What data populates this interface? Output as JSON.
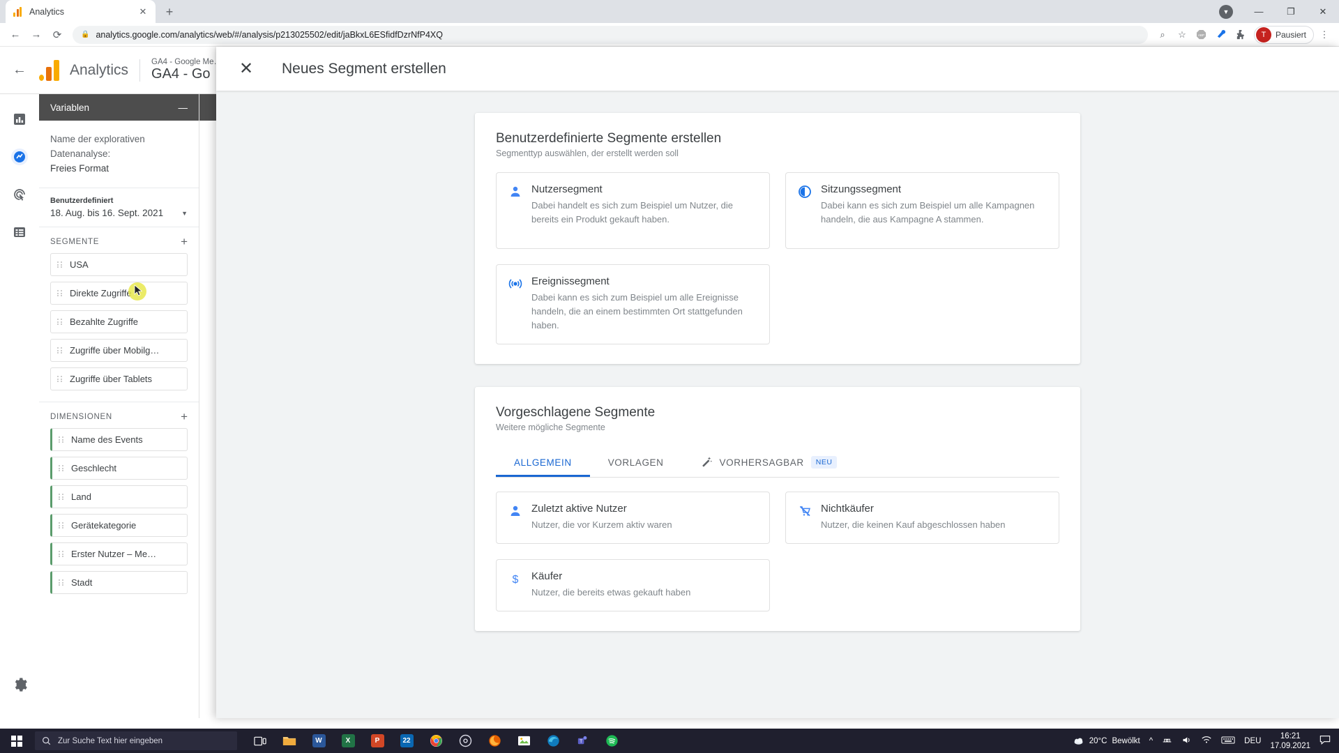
{
  "browser": {
    "tab": {
      "title": "Analytics",
      "favicon": "analytics-icon",
      "close": "✕"
    },
    "new_tab": "+",
    "window_controls": {
      "minimize": "—",
      "maximize": "❐",
      "close": "✕"
    },
    "nav": {
      "back": "←",
      "forward": "→",
      "reload": "⟳"
    },
    "omnibox": {
      "lock": "🔒",
      "url": "analytics.google.com/analytics/web/#/analysis/p213025502/edit/jaBkxL6ESfidfDzrNfP4XQ"
    },
    "toolbar_icons": [
      "zoom-icon",
      "bookmark-star-icon",
      "adblock-icon",
      "extension-blue-icon",
      "extensions-puzzle-icon"
    ],
    "profile": {
      "initial": "T",
      "label": "Pausiert"
    },
    "menu": "⋮"
  },
  "app": {
    "back": "←",
    "brand": "Analytics",
    "property_small": "GA4 - Google Me…",
    "property_big": "GA4 - Go",
    "rail": [
      "reports-icon",
      "explore-icon",
      "advertising-icon",
      "configure-icon",
      "admin-gear-icon"
    ]
  },
  "variables": {
    "header": "Variablen",
    "collapse": "—",
    "analysis_label": "Name der explorativen Datenanalyse:",
    "analysis_value": "Freies Format",
    "date_label": "Benutzerdefiniert",
    "date_value": "18. Aug. bis 16. Sept. 2021",
    "segments": {
      "title": "SEGMENTE",
      "add": "+",
      "items": [
        "USA",
        "Direkte Zugriffe",
        "Bezahlte Zugriffe",
        "Zugriffe über Mobilg…",
        "Zugriffe über Tablets"
      ]
    },
    "dimensions": {
      "title": "DIMENSIONEN",
      "add": "+",
      "items": [
        "Name des Events",
        "Geschlecht",
        "Land",
        "Gerätekategorie",
        "Erster Nutzer – Me…",
        "Stadt"
      ]
    }
  },
  "modal": {
    "close": "✕",
    "title": "Neues Segment erstellen",
    "custom": {
      "title": "Benutzerdefinierte Segmente erstellen",
      "subtitle": "Segmenttyp auswählen, der erstellt werden soll",
      "tiles": [
        {
          "icon": "person-icon",
          "name": "Nutzersegment",
          "desc": "Dabei handelt es sich zum Beispiel um Nutzer, die bereits ein Produkt gekauft haben."
        },
        {
          "icon": "session-clock-icon",
          "name": "Sitzungssegment",
          "desc": "Dabei kann es sich zum Beispiel um alle Kampagnen handeln, die aus Kampagne A stammen."
        },
        {
          "icon": "event-target-icon",
          "name": "Ereignissegment",
          "desc": "Dabei kann es sich zum Beispiel um alle Ereignisse handeln, die an einem bestimmten Ort stattgefunden haben."
        }
      ]
    },
    "suggested": {
      "title": "Vorgeschlagene Segmente",
      "subtitle": "Weitere mögliche Segmente",
      "tabs": [
        {
          "label": "ALLGEMEIN",
          "active": true,
          "icon": null,
          "badge": null
        },
        {
          "label": "VORLAGEN",
          "active": false,
          "icon": null,
          "badge": null
        },
        {
          "label": "VORHERSAGBAR",
          "active": false,
          "icon": "magic-wand-icon",
          "badge": "NEU"
        }
      ],
      "tiles": [
        {
          "icon": "person-icon",
          "name": "Zuletzt aktive Nutzer",
          "desc": "Nutzer, die vor Kurzem aktiv waren"
        },
        {
          "icon": "no-cart-icon",
          "name": "Nichtkäufer",
          "desc": "Nutzer, die keinen Kauf abgeschlossen haben"
        },
        {
          "icon": "dollar-icon",
          "name": "Käufer",
          "desc": "Nutzer, die bereits etwas gekauft haben"
        }
      ]
    }
  },
  "taskbar": {
    "start": "start-icon",
    "search_placeholder": "Zur Suche Text hier eingeben",
    "apps": [
      {
        "name": "task-view-icon",
        "letter": "",
        "color": "transparent"
      },
      {
        "name": "file-explorer-icon",
        "letter": "",
        "color": "#f7b84b"
      },
      {
        "name": "word-icon",
        "letter": "W",
        "color": "#2b579a"
      },
      {
        "name": "excel-icon",
        "letter": "X",
        "color": "#217346"
      },
      {
        "name": "powerpoint-icon",
        "letter": "P",
        "color": "#d24726"
      },
      {
        "name": "mail-icon",
        "letter": "22",
        "color": "#0a67b2"
      },
      {
        "name": "chrome-icon",
        "letter": "",
        "color": "#4285f4"
      },
      {
        "name": "disc-icon",
        "letter": "",
        "color": "#5f6368"
      },
      {
        "name": "firefox-icon",
        "letter": "",
        "color": "#e66000"
      },
      {
        "name": "photos-icon",
        "letter": "",
        "color": "#6fbf4b"
      },
      {
        "name": "edge-icon",
        "letter": "",
        "color": "#0f7bbd"
      },
      {
        "name": "teams-icon",
        "letter": "",
        "color": "#5b5fc7"
      },
      {
        "name": "spotify-icon",
        "letter": "",
        "color": "#1db954"
      }
    ],
    "weather": {
      "temp": "20°C",
      "text": "Bewölkt"
    },
    "tray_icons": [
      "chevron-up-icon",
      "onedrive-icon",
      "volume-icon",
      "network-icon",
      "keyboard-icon"
    ],
    "language": "DEU",
    "time": "16:21",
    "date": "17.09.2021",
    "notification": "notification-icon"
  }
}
